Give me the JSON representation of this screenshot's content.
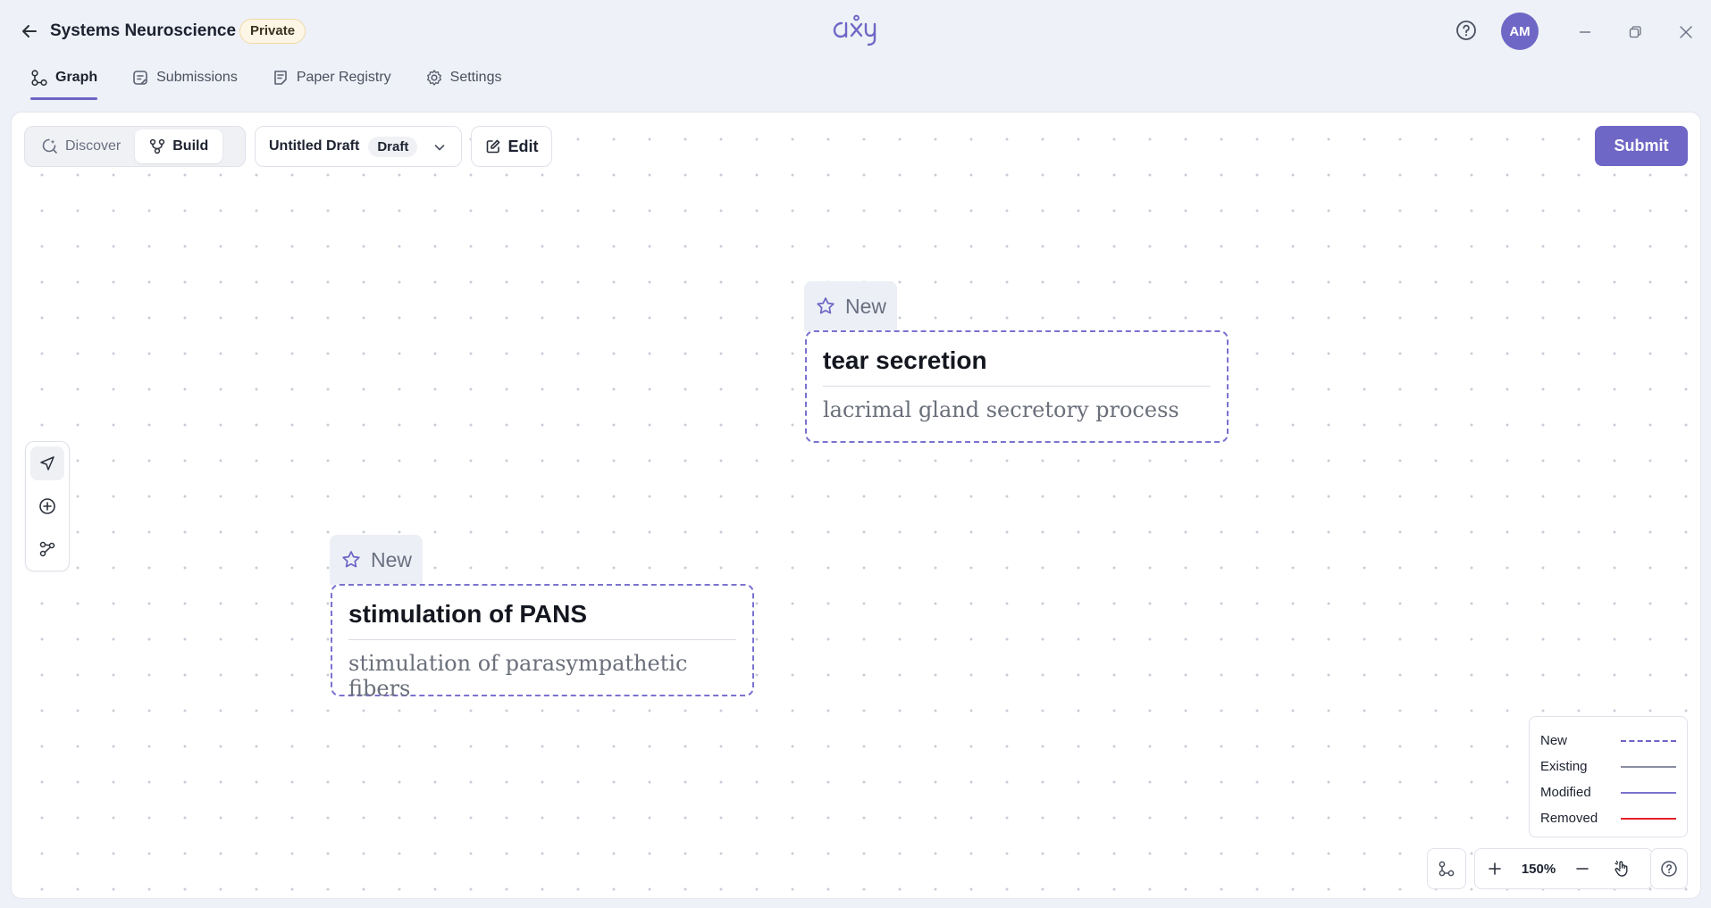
{
  "header": {
    "project_title": "Systems Neuroscience",
    "privacy": "Private",
    "logo_text": "axy",
    "avatar_initials": "AM"
  },
  "tabs": [
    {
      "label": "Graph",
      "icon": "graph-icon",
      "active": true
    },
    {
      "label": "Submissions",
      "icon": "submissions-icon",
      "active": false
    },
    {
      "label": "Paper Registry",
      "icon": "paper-registry-icon",
      "active": false
    },
    {
      "label": "Settings",
      "icon": "gear-icon",
      "active": false
    }
  ],
  "toolbar": {
    "modes": [
      {
        "label": "Discover",
        "icon": "discover-icon",
        "active": false
      },
      {
        "label": "Build",
        "icon": "build-icon",
        "active": true
      }
    ],
    "draft_name": "Untitled Draft",
    "draft_status": "Draft",
    "edit_label": "Edit",
    "submit_label": "Submit"
  },
  "tools": [
    {
      "name": "pointer-tool",
      "icon": "navigation-arrow-icon",
      "active": true
    },
    {
      "name": "add-node-tool",
      "icon": "plus-circle-icon",
      "active": false
    },
    {
      "name": "connect-tool",
      "icon": "connect-nodes-icon",
      "active": false
    }
  ],
  "nodes": [
    {
      "tag": "New",
      "title": "tear secretion",
      "description": "lacrimal gland secretory process"
    },
    {
      "tag": "New",
      "title": "stimulation of PANS",
      "description": "stimulation of parasympathetic fibers"
    }
  ],
  "legend": [
    {
      "label": "New",
      "style": "dashed",
      "color": "#6d64c5"
    },
    {
      "label": "Existing",
      "style": "solid",
      "color": "#8a8fa0"
    },
    {
      "label": "Modified",
      "style": "solid",
      "color": "#7a72cf"
    },
    {
      "label": "Removed",
      "style": "solid",
      "color": "#e5202a"
    }
  ],
  "zoom": {
    "value": "150%"
  },
  "colors": {
    "accent": "#6f67c6",
    "node_border": "#7a72cf",
    "privacy_badge_bg": "#fdf6e6"
  }
}
